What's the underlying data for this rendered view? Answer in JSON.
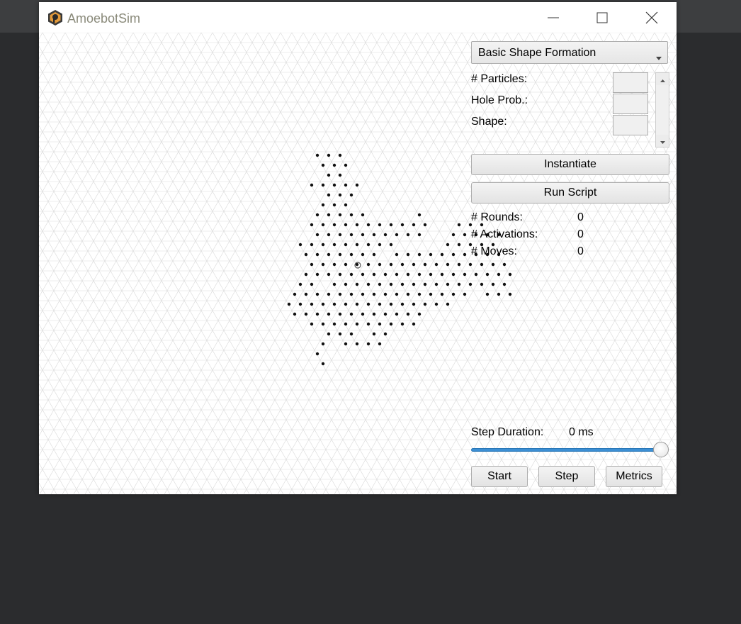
{
  "window": {
    "title": "AmoebotSim"
  },
  "controls": {
    "algorithm_select": {
      "selected": "Basic Shape Formation"
    },
    "params": [
      {
        "label": "# Particles:"
      },
      {
        "label": "Hole Prob.:"
      },
      {
        "label": "Shape:"
      }
    ],
    "instantiate_label": "Instantiate",
    "run_script_label": "Run Script"
  },
  "stats": [
    {
      "label": "# Rounds:",
      "value": "0"
    },
    {
      "label": "# Activations:",
      "value": "0"
    },
    {
      "label": "# Moves:",
      "value": "0"
    }
  ],
  "playback": {
    "step_duration_label": "Step Duration:",
    "step_duration_value": "0 ms",
    "slider_fraction": 1.0,
    "start_label": "Start",
    "step_label": "Step",
    "metrics_label": "Metrics"
  },
  "colors": {
    "grid_line": "#d9d9d9",
    "particle": "#111111",
    "slider_fill": "#3c8fd4"
  },
  "icons": {
    "app": "amoebot-hexagon-icon",
    "minimize": "minimize-icon",
    "maximize": "maximize-icon",
    "close": "close-icon"
  }
}
